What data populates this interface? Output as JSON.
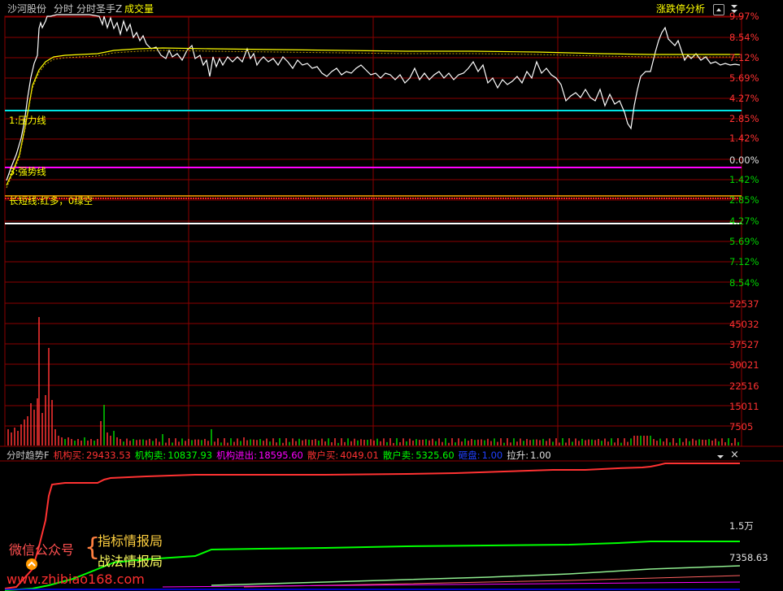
{
  "header": {
    "stock_name": "沙河股份",
    "tab_timeshare": "分时",
    "indicator_main": "分时圣手Z",
    "indicator_volume": "成交量",
    "limit_analysis": "涨跌停分析",
    "up_icon": "collapse-up-icon",
    "menu_icon": "scroll-down-icon"
  },
  "price_axis": {
    "up_labels": [
      "9.97%",
      "8.54%",
      "7.12%",
      "5.69%",
      "4.27%",
      "2.85%",
      "1.42%"
    ],
    "zero_label": "0.00%",
    "down_labels": [
      "1.42%",
      "2.85%",
      "4.27%",
      "5.69%",
      "7.12%",
      "8.54%"
    ]
  },
  "chart_labels": {
    "pressure_line": "1:压力线",
    "strong_line": "3:强势线",
    "long_short_line": "长短线:红多，0绿空"
  },
  "volume_axis": {
    "labels": [
      "52537",
      "45032",
      "37527",
      "30021",
      "22516",
      "15011",
      "7505"
    ]
  },
  "indicator_panel": {
    "title": "分时趋势F",
    "inst_buy_label": "机构买:",
    "inst_buy_value": "29433.53",
    "inst_sell_label": "机构卖:",
    "inst_sell_value": "10837.93",
    "inst_net_label": "机构进出:",
    "inst_net_value": "18595.60",
    "retail_buy_label": "散户买:",
    "retail_buy_value": "4049.01",
    "retail_sell_label": "散户卖:",
    "retail_sell_value": "5325.60",
    "dump_label": "砸盘:",
    "dump_value": "1.00",
    "pull_label": "拉升:",
    "pull_value": "1.00",
    "axis_top": "1.5万",
    "axis_bottom": "7358.63",
    "dropdown_icon": "dropdown-arrow-icon",
    "close_icon": "close-icon"
  },
  "watermark": {
    "wechat": "微信公众号",
    "brace": "{",
    "line1": "指标情报局",
    "line2": "战法情报局",
    "url": "www.zhibiao168.com"
  },
  "colors": {
    "grid": "#8b0000",
    "up": "#ff3232",
    "down": "#00d200",
    "price_line": "#ffffff",
    "avg_line": "#ffff00",
    "pressure": "#00e5e5",
    "strong": "#ff00ff",
    "header_yellow": "#ffff00",
    "inst_buy": "#ff3232",
    "inst_sell": "#00ff00",
    "inst_net": "#ff00ff",
    "retail_buy": "#ff3232",
    "retail_sell": "#00ff00",
    "dump": "#0000ff"
  }
}
